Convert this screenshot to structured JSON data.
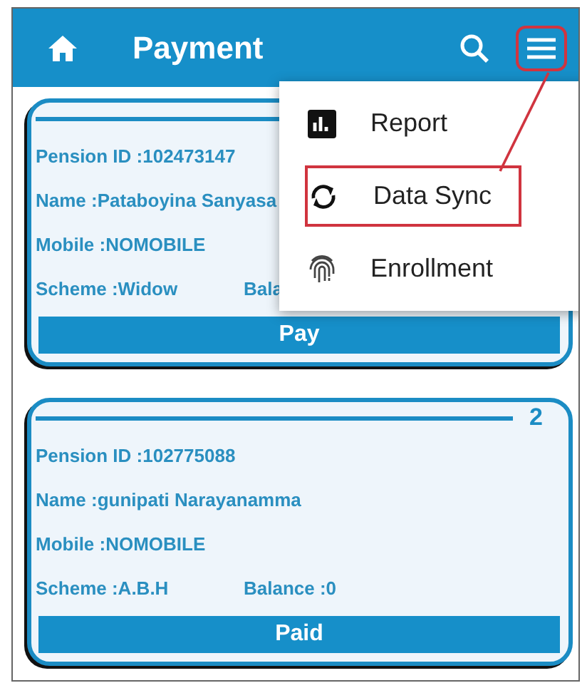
{
  "app_bar": {
    "title": "Payment",
    "menu_button_highlighted": true
  },
  "cards": [
    {
      "pension_id": "Pension ID :102473147",
      "name": "Name :Pataboyina Sanyasa",
      "mobile": "Mobile :NOMOBILE",
      "scheme": "Scheme :Widow",
      "balance": "Bala",
      "action": "Pay"
    },
    {
      "number": "2",
      "pension_id": "Pension ID :102775088",
      "name": "Name :gunipati  Narayanamma",
      "mobile": "Mobile :NOMOBILE",
      "scheme": "Scheme :A.B.H",
      "balance": "Balance :0",
      "action": "Paid"
    }
  ],
  "menu": {
    "items": [
      {
        "kind": "report",
        "label": "Report",
        "highlighted": false
      },
      {
        "kind": "sync",
        "label": "Data Sync",
        "highlighted": true
      },
      {
        "kind": "fingerprint",
        "label": "Enrollment",
        "highlighted": false
      }
    ]
  }
}
